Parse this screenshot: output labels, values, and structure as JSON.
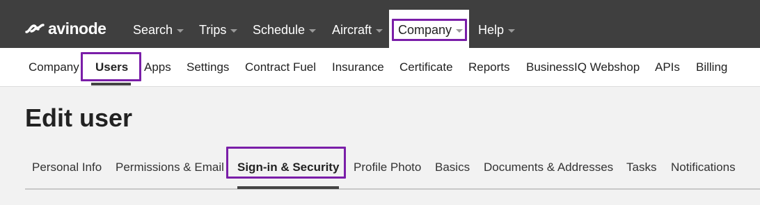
{
  "brand": {
    "logo_text": "avinode",
    "logo_icon": "avinode-logo-icon"
  },
  "topnav": {
    "items": [
      {
        "label": "Search",
        "has_caret": true,
        "active": false
      },
      {
        "label": "Trips",
        "has_caret": true,
        "active": false
      },
      {
        "label": "Schedule",
        "has_caret": true,
        "active": false
      },
      {
        "label": "Aircraft",
        "has_caret": true,
        "active": false
      },
      {
        "label": "Company",
        "has_caret": true,
        "active": true
      },
      {
        "label": "Help",
        "has_caret": true,
        "active": false
      }
    ]
  },
  "subnav": {
    "items": [
      {
        "label": "Company",
        "active": false
      },
      {
        "label": "Users",
        "active": true
      },
      {
        "label": "Apps",
        "active": false
      },
      {
        "label": "Settings",
        "active": false
      },
      {
        "label": "Contract Fuel",
        "active": false
      },
      {
        "label": "Insurance",
        "active": false
      },
      {
        "label": "Certificate",
        "active": false
      },
      {
        "label": "Reports",
        "active": false
      },
      {
        "label": "BusinessIQ Webshop",
        "active": false
      },
      {
        "label": "APIs",
        "active": false
      },
      {
        "label": "Billing",
        "active": false
      }
    ]
  },
  "page": {
    "title": "Edit user"
  },
  "tabs": {
    "items": [
      {
        "label": "Personal Info",
        "active": false
      },
      {
        "label": "Permissions & Email",
        "active": false
      },
      {
        "label": "Sign-in & Security",
        "active": true
      },
      {
        "label": "Profile Photo",
        "active": false
      },
      {
        "label": "Basics",
        "active": false
      },
      {
        "label": "Documents & Addresses",
        "active": false
      },
      {
        "label": "Tasks",
        "active": false
      },
      {
        "label": "Notifications",
        "active": false
      }
    ]
  },
  "colors": {
    "topbar_bg": "#3f3f3f",
    "highlight": "#7a1ea8",
    "active_underline": "#444444",
    "page_bg": "#f2f2f2"
  }
}
